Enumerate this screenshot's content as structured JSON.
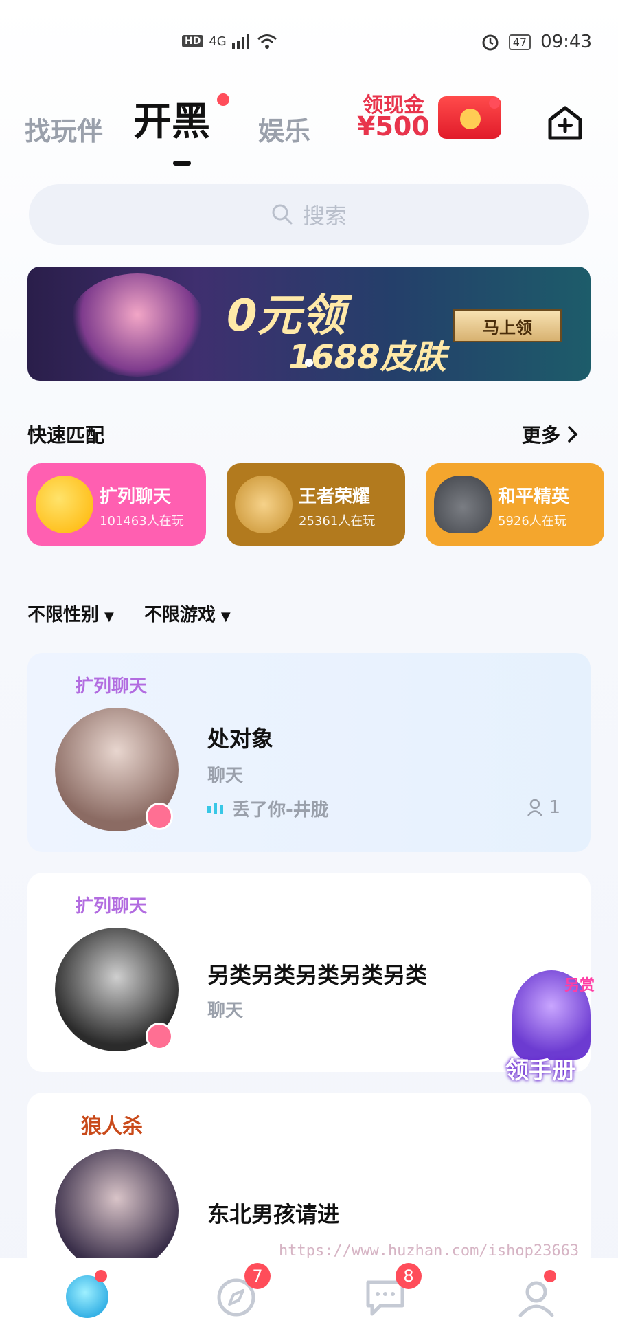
{
  "status_bar": {
    "left_labels": [
      "HD",
      "4G"
    ],
    "time": "09:43",
    "battery": "47"
  },
  "top_tabs": [
    {
      "label": "找玩伴"
    },
    {
      "label": "开黑"
    },
    {
      "label": "娱乐"
    }
  ],
  "promo": {
    "line1": "领现金",
    "line2": "¥500"
  },
  "search": {
    "placeholder": "搜索"
  },
  "banner": {
    "headline": "0元领",
    "subline": "1688皮肤",
    "cta": "马上领"
  },
  "quick_match": {
    "title": "快速匹配",
    "more": "更多",
    "items": [
      {
        "name": "扩列聊天",
        "sub": "101463人在玩",
        "color": "#ff5fb1"
      },
      {
        "name": "王者荣耀",
        "sub": "25361人在玩",
        "color": "#b27a1e"
      },
      {
        "name": "和平精英",
        "sub": "5926人在玩",
        "color": "#f4a62d"
      }
    ]
  },
  "filters": {
    "gender": "不限性别",
    "game": "不限游戏"
  },
  "rooms": [
    {
      "tag": "扩列聊天",
      "title": "处对象",
      "category": "聊天",
      "song": "丢了你-井胧",
      "count": "1"
    },
    {
      "tag": "扩列聊天",
      "title": "另类另类另类另类另类",
      "category": "聊天"
    },
    {
      "tag": "狼人杀",
      "title": "东北男孩请进"
    }
  ],
  "floater": {
    "top": "另赏",
    "label": "领手册"
  },
  "watermark": "https://www.huzhan.com/ishop23663",
  "bottom_nav": {
    "discover_badge": "7",
    "message_badge": "8"
  }
}
